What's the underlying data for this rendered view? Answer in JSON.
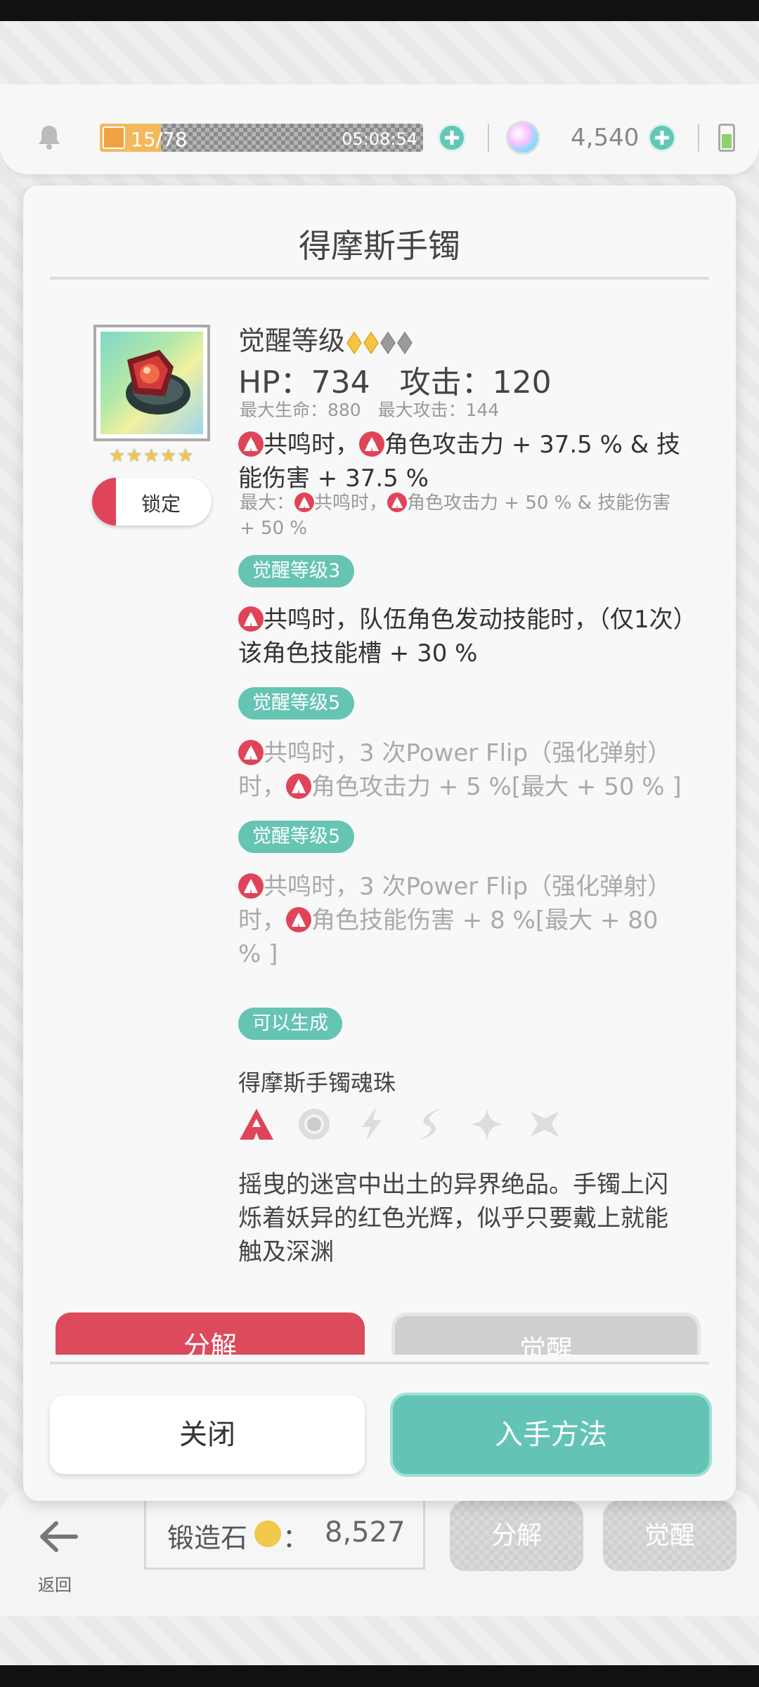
{
  "topbar": {
    "energy_current": "15",
    "energy_max": "/78",
    "energy_fill_fraction": 0.19,
    "energy_timer": "05:08:54",
    "gem_count": "4,540"
  },
  "dialog": {
    "title": "得摩斯手镯",
    "item": {
      "rarity_stars": "★★★★★",
      "lock_label": "锁定"
    },
    "awaken_label": "觉醒等级",
    "awaken_filled": 2,
    "awaken_total": 4,
    "stats": {
      "hp_label": "HP：",
      "hp_value": "734",
      "atk_label": "攻击：",
      "atk_value": "120",
      "max_hp": "最大生命：880",
      "max_atk": "最大攻击：144"
    },
    "effect_main_1": "共鸣时，",
    "effect_main_2": "角色攻击力 + 37.5 % & 技能伤害 + 37.5 %",
    "effect_max_1": "最大：",
    "effect_max_2": "共鸣时，",
    "effect_max_3": "角色攻击力 + 50 % & 技能伤害 + 50 %",
    "tag_1": "觉醒等级3",
    "effect_3": "共鸣时，队伍角色发动技能时，（仅1次）该角色技能槽 + 30 %",
    "tag_2": "觉醒等级5",
    "effect_5a_1": "共鸣时，3 次Power Flip（强化弹射）时，",
    "effect_5a_2": "角色攻击力 + 5 %[最大 + 50 % ]",
    "tag_3": "觉醒等级5",
    "effect_5b_1": "共鸣时，3 次Power Flip（强化弹射）时，",
    "effect_5b_2": "角色技能伤害 + 8 %[最大 + 80 % ]",
    "tag_4": "可以生成",
    "soul_name": "得摩斯手镯魂珠",
    "elements": [
      "fire-icon",
      "light-icon",
      "thunder-icon",
      "wind-icon",
      "star-icon",
      "dark-icon"
    ],
    "description": "摇曳的迷宫中出土的异界绝品。手镯上闪烁着妖异的红色光辉，似乎只要戴上就能触及深渊",
    "decompose_label": "分解",
    "awaken_button_label": "觉醒",
    "close_label": "关闭",
    "obtain_label": "入手方法"
  },
  "bottom": {
    "back_label": "返回",
    "forge_label": "锻造石",
    "forge_colon": "：",
    "forge_value": "8,527",
    "bg_decompose": "分解",
    "bg_awaken": "觉醒"
  },
  "colors": {
    "accent_teal": "#63c4b5",
    "danger_red": "#e04459"
  }
}
